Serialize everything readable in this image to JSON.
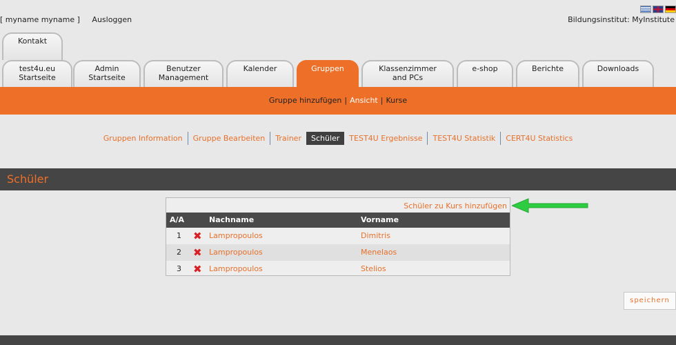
{
  "header": {
    "user_label": "[ myname myname ]",
    "logout_label": "Ausloggen",
    "institute_label": "Bildungsinstitut: MyInstitute",
    "flags": [
      {
        "name": "greek-flag-icon",
        "color": "#2a5db0"
      },
      {
        "name": "uk-flag-icon",
        "color": "#2a3e8f"
      },
      {
        "name": "german-flag-icon",
        "color": "#d00000"
      }
    ]
  },
  "tabs_top": [
    {
      "id": "kontakt",
      "label": "Kontakt"
    }
  ],
  "tabs": [
    {
      "id": "test4u",
      "line1": "test4u.eu",
      "line2": "Startseite",
      "active": false
    },
    {
      "id": "admin",
      "line1": "Admin",
      "line2": "Startseite",
      "active": false
    },
    {
      "id": "benutzer",
      "line1": "Benutzer",
      "line2": "Management",
      "active": false
    },
    {
      "id": "kalender",
      "line1": "Kalender",
      "line2": "",
      "active": false
    },
    {
      "id": "gruppen",
      "line1": "Gruppen",
      "line2": "",
      "active": true
    },
    {
      "id": "klassenzimmer",
      "line1": "Klassenzimmer",
      "line2": "and PCs",
      "active": false
    },
    {
      "id": "eshop",
      "line1": "e-shop",
      "line2": "",
      "active": false
    },
    {
      "id": "berichte",
      "line1": "Berichte",
      "line2": "",
      "active": false
    },
    {
      "id": "downloads",
      "line1": "Downloads",
      "line2": "",
      "active": false
    }
  ],
  "subbar": {
    "items": [
      {
        "label": "Gruppe hinzufügen",
        "selected": false
      },
      {
        "label": "Ansicht",
        "selected": true
      },
      {
        "label": "Kurse",
        "selected": false
      }
    ]
  },
  "subnav": {
    "items": [
      {
        "label": "Gruppen Information",
        "current": false
      },
      {
        "label": "Gruppe Bearbeiten",
        "current": false
      },
      {
        "label": "Trainer",
        "current": false
      },
      {
        "label": "Schüler",
        "current": true
      },
      {
        "label": "TEST4U Ergebnisse",
        "current": false
      },
      {
        "label": "TEST4U Statistik",
        "current": false
      },
      {
        "label": "CERT4U Statistics",
        "current": false
      }
    ]
  },
  "section": {
    "title": "Schüler"
  },
  "students": {
    "add_link": "Schüler zu Kurs hinzufügen",
    "columns": {
      "aa": "A/A",
      "lastname": "Nachname",
      "firstname": "Vorname"
    },
    "rows": [
      {
        "aa": "1",
        "lastname": "Lampropoulos",
        "firstname": "Dimitris"
      },
      {
        "aa": "2",
        "lastname": "Lampropoulos",
        "firstname": "Menelaos"
      },
      {
        "aa": "3",
        "lastname": "Lampropoulos",
        "firstname": "Stelios"
      }
    ]
  },
  "save_label": "speichern",
  "colors": {
    "accent": "#ee7028",
    "dark": "#454545",
    "arrow": "#2ecc40"
  }
}
